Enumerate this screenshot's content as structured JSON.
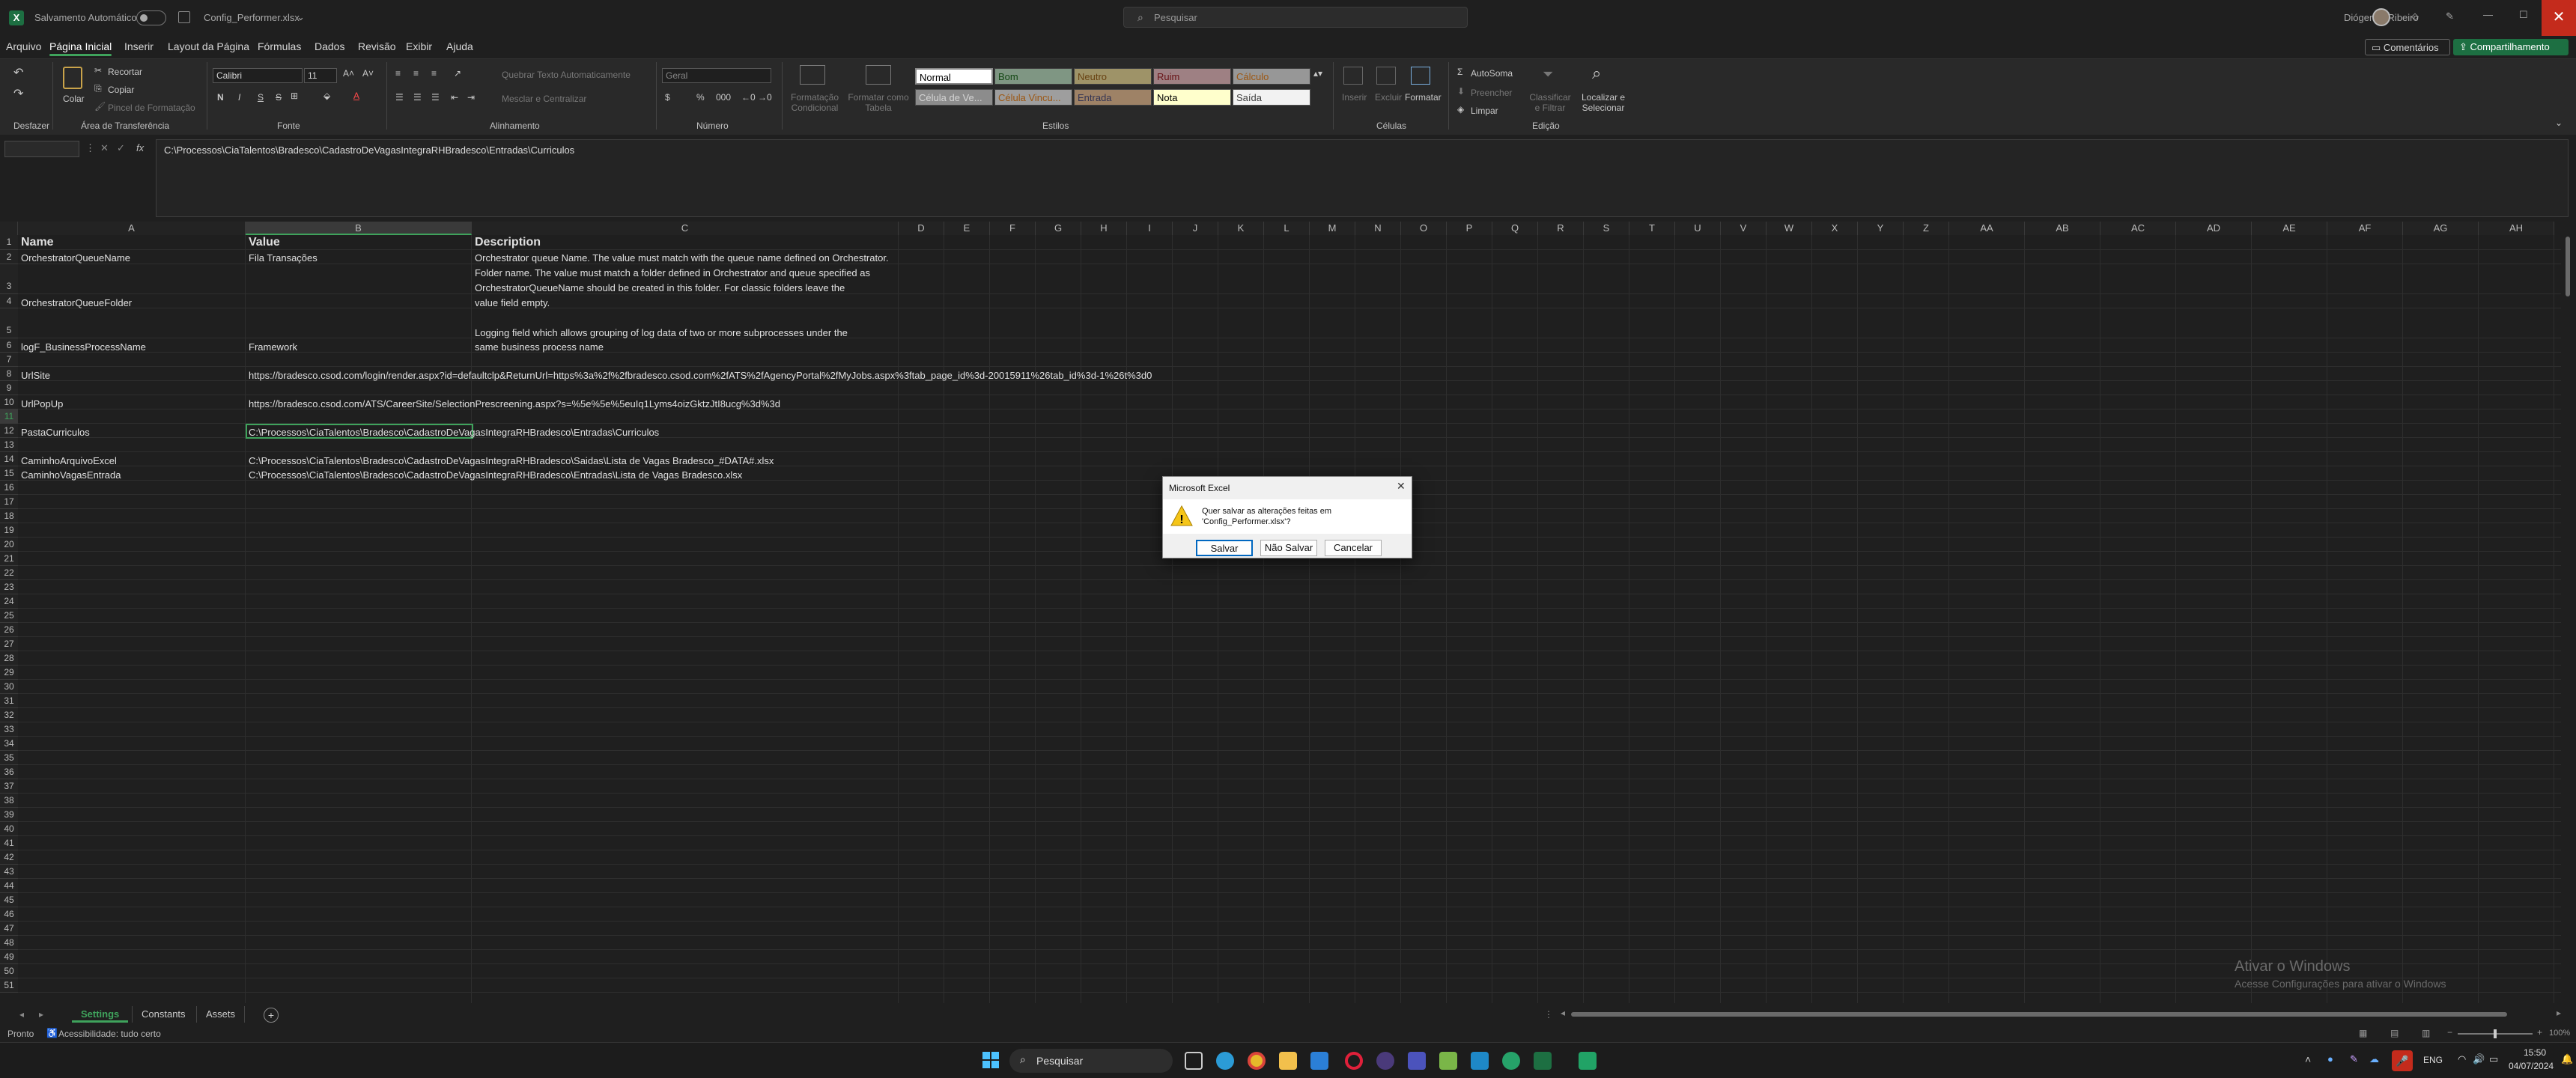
{
  "titlebar": {
    "autosave_label": "Salvamento Automático",
    "doc_title": "Config_Performer.xlsx",
    "search_placeholder": "Pesquisar",
    "user_name": "Diógenes Ribeiro"
  },
  "menu": {
    "items": [
      "Arquivo",
      "Página Inicial",
      "Inserir",
      "Layout da Página",
      "Fórmulas",
      "Dados",
      "Revisão",
      "Exibir",
      "Ajuda"
    ],
    "active": "Página Inicial",
    "comments_label": "Comentários",
    "share_label": "Compartilhamento"
  },
  "ribbon": {
    "undo_group": "Desfazer",
    "clipboard": {
      "paste": "Colar",
      "cut": "Recortar",
      "copy": "Copiar",
      "format_painter": "Pincel de Formatação",
      "group": "Área de Transferência"
    },
    "font": {
      "name": "Calibri",
      "size": "11",
      "group": "Fonte",
      "bold": "N",
      "italic": "I",
      "underline": "S",
      "strike": "S",
      "color_a": "A"
    },
    "alignment": {
      "wrap": "Quebrar Texto Automaticamente",
      "merge": "Mesclar e Centralizar",
      "group": "Alinhamento"
    },
    "number": {
      "format": "Geral",
      "group": "Número"
    },
    "styles": {
      "cond_format": "Formatação Condicional",
      "format_table": "Formatar como Tabela",
      "group": "Estilos",
      "row1": [
        "Normal",
        "Bom",
        "Neutro",
        "Ruim",
        "Cálculo"
      ],
      "row2": [
        "Célula de Ve...",
        "Célula Vincu...",
        "Entrada",
        "Nota",
        "Saída"
      ]
    },
    "cells": {
      "insert": "Inserir",
      "delete": "Excluir",
      "format": "Formatar",
      "group": "Células"
    },
    "editing": {
      "autosum": "AutoSoma",
      "fill": "Preencher",
      "clear": "Limpar",
      "sort": "Classificar e Filtrar",
      "find": "Localizar e Selecionar",
      "group": "Edição"
    }
  },
  "formula_bar": {
    "name_box": "",
    "fx": "fx",
    "content": "C:\\Processos\\CiaTalentos\\Bradesco\\CadastroDeVagasIntegraRHBradesco\\Entradas\\Curriculos"
  },
  "grid": {
    "columns": [
      "A",
      "B",
      "C",
      "D",
      "E",
      "F",
      "G",
      "H",
      "I",
      "J",
      "K",
      "L",
      "M",
      "N",
      "O",
      "P",
      "Q",
      "R",
      "S",
      "T",
      "U",
      "V",
      "W",
      "X",
      "Y",
      "Z",
      "AA",
      "AB",
      "AC",
      "AD",
      "AE",
      "AF",
      "AG",
      "AH"
    ],
    "row_numbers": [
      "1",
      "2",
      "3",
      "4",
      "5",
      "6",
      "7",
      "8",
      "9",
      "10",
      "11",
      "12",
      "13",
      "14",
      "15",
      "16",
      "17",
      "18",
      "19",
      "20",
      "21",
      "22",
      "23",
      "24",
      "25",
      "26",
      "27",
      "28",
      "29",
      "30",
      "31",
      "32",
      "33",
      "34",
      "35",
      "36",
      "37",
      "38",
      "39",
      "40",
      "41",
      "42",
      "43",
      "44",
      "45",
      "46",
      "47",
      "48",
      "49",
      "50",
      "51"
    ],
    "headers": {
      "a": "Name",
      "b": "Value",
      "c": "Description"
    },
    "r2": {
      "a": "OrchestratorQueueName",
      "b": "Fila Transações",
      "c": "Orchestrator queue Name. The value must match with the queue name defined on Orchestrator."
    },
    "r3": {
      "a": "OrchestratorQueueFolder",
      "c1": "Folder name. The value must match a folder defined in Orchestrator and queue specified as",
      "c2": "OrchestratorQueueName should be created in this folder. For classic folders leave the",
      "c3": "value field empty."
    },
    "r5": {
      "a": "logF_BusinessProcessName",
      "b": "Framework",
      "c1": "Logging field which allows grouping of log data of two or more subprocesses under the",
      "c2": "same business process name"
    },
    "r7": {
      "a": "UrlSite",
      "b": "https://bradesco.csod.com/login/render.aspx?id=defaultclp&ReturnUrl=https%3a%2f%2fbradesco.csod.com%2fATS%2fAgencyPortal%2fMyJobs.aspx%3ftab_page_id%3d-20015911%26tab_id%3d-1%26t%3d0"
    },
    "r9": {
      "a": "UrlPopUp",
      "b": "https://bradesco.csod.com/ATS/CareerSite/SelectionPrescreening.aspx?s=%5e%5e%5euIq1Lyms4oizGktzJtI8ucg%3d%3d"
    },
    "r11": {
      "a": "PastaCurriculos",
      "b": "C:\\Processos\\CiaTalentos\\Bradesco\\CadastroDeVagasIntegraRHBradesco\\Entradas\\Curriculos"
    },
    "r13": {
      "a": "CaminhoArquivoExcel",
      "b": "C:\\Processos\\CiaTalentos\\Bradesco\\CadastroDeVagasIntegraRHBradesco\\Saidas\\Lista de Vagas Bradesco_#DATA#.xlsx"
    },
    "r14": {
      "a": "CaminhoVagasEntrada",
      "b": "C:\\Processos\\CiaTalentos\\Bradesco\\CadastroDeVagasIntegraRHBradesco\\Entradas\\Lista de Vagas Bradesco.xlsx"
    }
  },
  "dialog": {
    "title": "Microsoft Excel",
    "message_line1": "Quer salvar as alterações feitas em",
    "message_line2": "'Config_Performer.xlsx'?",
    "save": "Salvar",
    "dont_save": "Não Salvar",
    "cancel": "Cancelar"
  },
  "watermark": {
    "line1": "Ativar o Windows",
    "line2": "Acesse Configurações para ativar o Windows"
  },
  "sheets": {
    "tabs": [
      "Settings",
      "Constants",
      "Assets"
    ],
    "active": "Settings"
  },
  "status": {
    "ready": "Pronto",
    "accessibility": "Acessibilidade: tudo certo",
    "zoom": "100%"
  },
  "taskbar": {
    "search": "Pesquisar",
    "lang": "ENG",
    "time": "15:50",
    "date": "04/07/2024"
  },
  "colors": {
    "accent": "#3fa35c",
    "excel_green": "#1d6f42",
    "close_red": "#c42b1c"
  }
}
